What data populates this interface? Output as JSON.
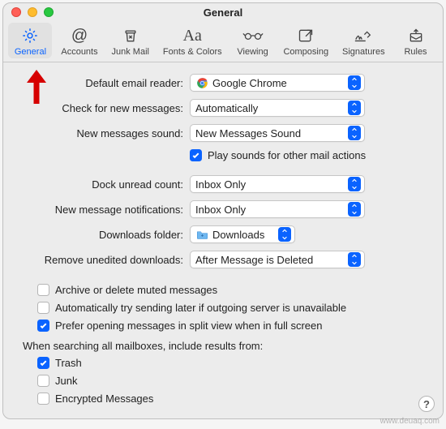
{
  "window": {
    "title": "General"
  },
  "toolbar": [
    {
      "id": "general",
      "label": "General",
      "selected": true
    },
    {
      "id": "accounts",
      "label": "Accounts",
      "selected": false
    },
    {
      "id": "junk",
      "label": "Junk Mail",
      "selected": false
    },
    {
      "id": "fonts",
      "label": "Fonts & Colors",
      "selected": false
    },
    {
      "id": "viewing",
      "label": "Viewing",
      "selected": false
    },
    {
      "id": "composing",
      "label": "Composing",
      "selected": false
    },
    {
      "id": "signatures",
      "label": "Signatures",
      "selected": false
    },
    {
      "id": "rules",
      "label": "Rules",
      "selected": false
    }
  ],
  "labels": {
    "default_reader": "Default email reader:",
    "check_messages": "Check for new messages:",
    "new_sound": "New messages sound:",
    "play_other": "Play sounds for other mail actions",
    "dock_unread": "Dock unread count:",
    "notifications": "New message notifications:",
    "downloads_folder": "Downloads folder:",
    "remove_downloads": "Remove unedited downloads:",
    "archive_muted": "Archive or delete muted messages",
    "auto_retry": "Automatically try sending later if outgoing server is unavailable",
    "split_view": "Prefer opening messages in split view when in full screen",
    "search_heading": "When searching all mailboxes, include results from:",
    "trash": "Trash",
    "junk_mb": "Junk",
    "encrypted": "Encrypted Messages"
  },
  "values": {
    "default_reader": "Google Chrome",
    "check_messages": "Automatically",
    "new_sound": "New Messages Sound",
    "dock_unread": "Inbox Only",
    "notifications": "Inbox Only",
    "downloads_folder": "Downloads",
    "remove_downloads": "After Message is Deleted"
  },
  "checks": {
    "play_other": true,
    "archive_muted": false,
    "auto_retry": false,
    "split_view": true,
    "trash": true,
    "junk_mb": false,
    "encrypted": false
  },
  "watermark": "www.deuaq.com"
}
